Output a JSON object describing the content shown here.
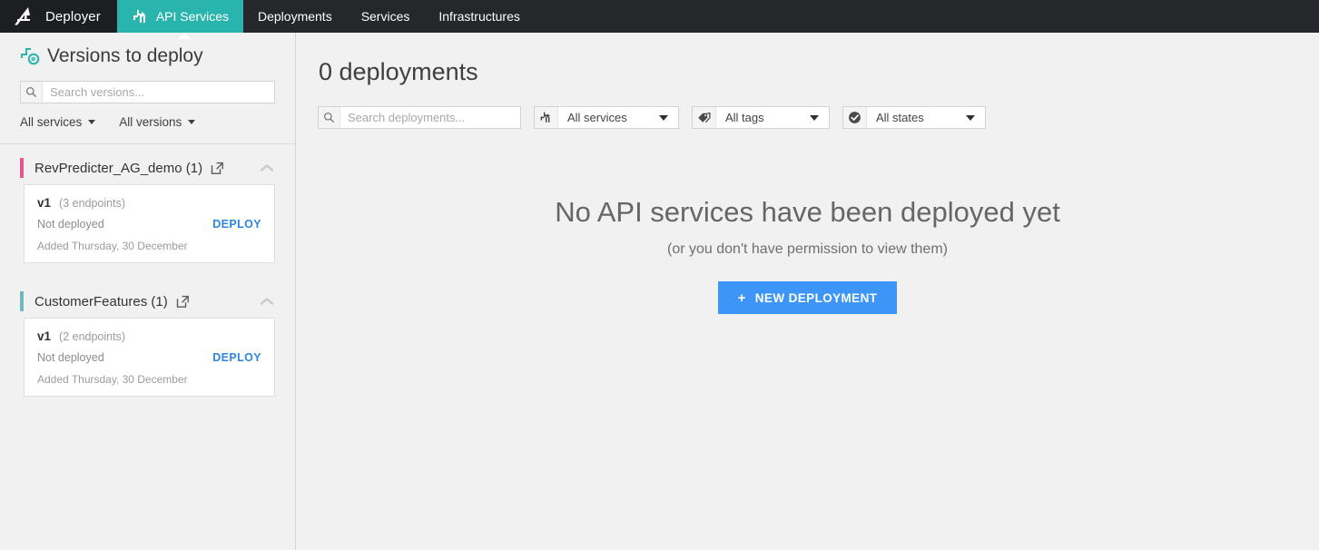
{
  "topnav": {
    "brand": "Deployer",
    "logo_icon": "bird-logo-icon",
    "items": [
      {
        "label": "API Services",
        "icon": "api-services-icon",
        "active": true
      },
      {
        "label": "Deployments",
        "icon": null,
        "active": false
      },
      {
        "label": "Services",
        "icon": null,
        "active": false
      },
      {
        "label": "Infrastructures",
        "icon": null,
        "active": false
      }
    ]
  },
  "sidebar": {
    "title": "Versions to deploy",
    "title_icon": "versions-graph-icon",
    "search": {
      "placeholder": "Search versions...",
      "value": "",
      "icon": "search-icon"
    },
    "filters": [
      {
        "label": "All services"
      },
      {
        "label": "All versions"
      }
    ],
    "groups": [
      {
        "name": "RevPredicter_AG_demo (1)",
        "bar_color": "#e5588f",
        "link_icon": "external-link-icon",
        "chevron_icon": "chevron-up-icon",
        "versions": [
          {
            "name": "v1",
            "endpoints": "(3 endpoints)",
            "status": "Not deployed",
            "action": "DEPLOY",
            "added": "Added Thursday, 30 December"
          }
        ]
      },
      {
        "name": "CustomerFeatures (1)",
        "bar_color": "#72b8bd",
        "link_icon": "external-link-icon",
        "chevron_icon": "chevron-up-icon",
        "versions": [
          {
            "name": "v1",
            "endpoints": "(2 endpoints)",
            "status": "Not deployed",
            "action": "DEPLOY",
            "added": "Added Thursday, 30 December"
          }
        ]
      }
    ]
  },
  "main": {
    "title": "0 deployments",
    "search": {
      "placeholder": "Search deployments...",
      "value": "",
      "icon": "search-icon"
    },
    "filters": [
      {
        "label": "All services",
        "icon": "services-icon"
      },
      {
        "label": "All tags",
        "icon": "tag-icon"
      },
      {
        "label": "All states",
        "icon": "check-circle-icon"
      }
    ],
    "empty_state": {
      "heading": "No API services have been deployed yet",
      "subheading": "(or you don't have permission to view them)",
      "button": "NEW DEPLOYMENT",
      "button_plus": "+"
    }
  },
  "colors": {
    "nav_bg": "#26272b",
    "nav_active": "#29b5ad",
    "accent_blue": "#3d96f7",
    "deploy_link": "#2f86dd",
    "page_bg": "#f1f1f1"
  }
}
